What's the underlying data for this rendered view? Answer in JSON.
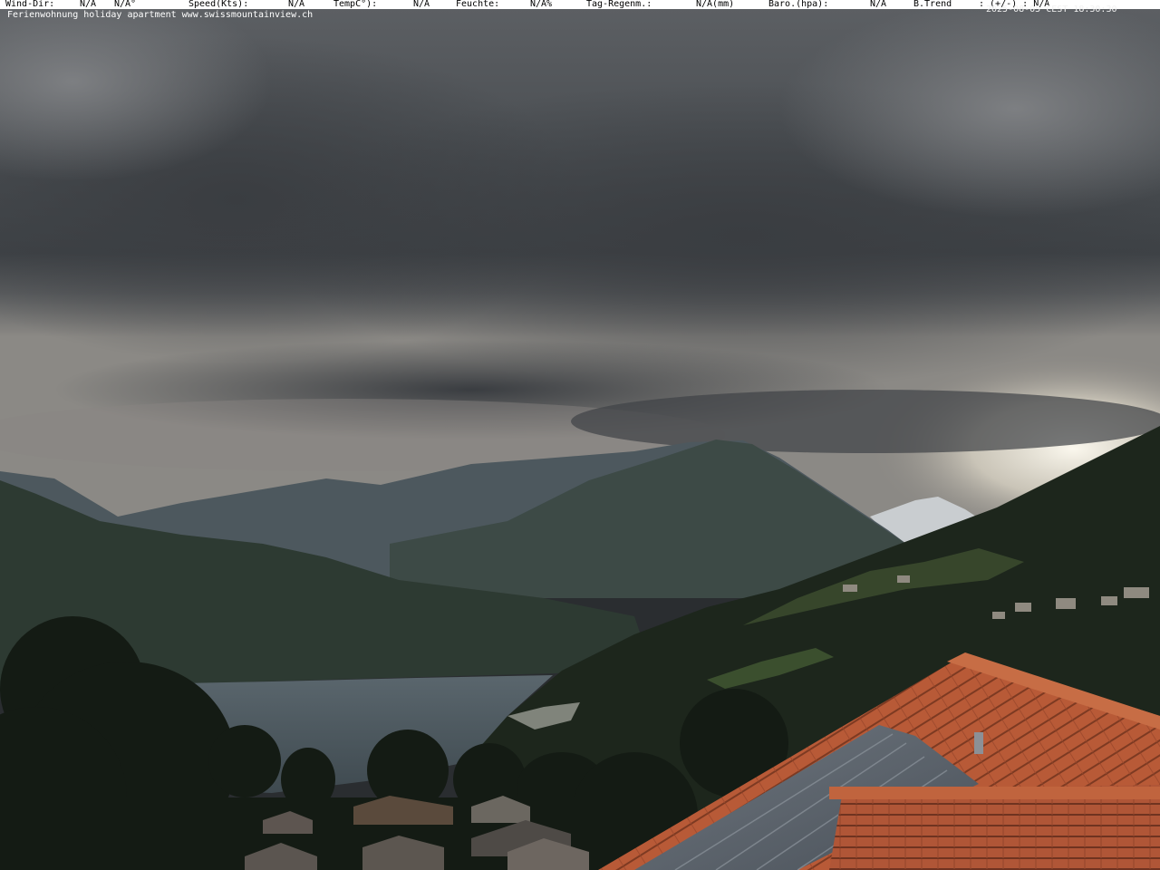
{
  "weather_bar": {
    "wind_label": "Wind-Dir:",
    "wind_dir": "N/A",
    "wind_deg": "N/A°",
    "speed_label": "Speed(Kts):",
    "speed_value": "N/A",
    "temp_label": "TempC°):",
    "temp_value": "N/A",
    "humidity_label": "Feuchte:",
    "humidity_value": "N/A%",
    "rain_label": "Tag-Regenm.:",
    "rain_value": "N/A(mm)",
    "baro_label": "Baro.(hpa):",
    "baro_value": "N/A",
    "trend_label": "B.Trend",
    "trend_value": ": (+/-) : N/A",
    "timestamp": "2025-08-05 CEST 18:30:30"
  },
  "caption": "Ferienwohnung holiday apartment www.swissmountainview.ch",
  "colors": {
    "sky_dark": "#3f4347",
    "sky_bright": "#f4f1e6",
    "lake": "#4b5961",
    "forest": "#1d261c",
    "roof_tile": "#b85a37"
  }
}
